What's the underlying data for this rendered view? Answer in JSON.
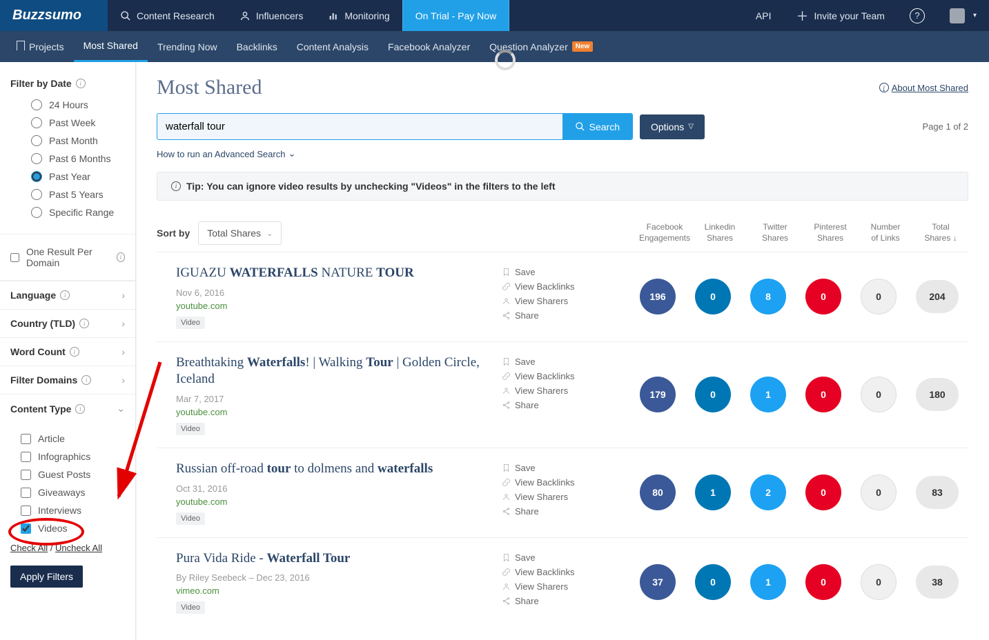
{
  "logo": "Buzzsumo",
  "topnav": {
    "content_research": "Content Research",
    "influencers": "Influencers",
    "monitoring": "Monitoring",
    "trial": "On Trial - Pay Now",
    "api": "API",
    "invite": "Invite your Team"
  },
  "subnav": {
    "projects": "Projects",
    "most_shared": "Most Shared",
    "trending": "Trending Now",
    "backlinks": "Backlinks",
    "content_analysis": "Content Analysis",
    "fb_analyzer": "Facebook Analyzer",
    "q_analyzer": "Question Analyzer",
    "new_badge": "New"
  },
  "sidebar": {
    "filter_date": "Filter by Date",
    "dates": [
      "24 Hours",
      "Past Week",
      "Past Month",
      "Past 6 Months",
      "Past Year",
      "Past 5 Years",
      "Specific Range"
    ],
    "date_selected": 4,
    "one_result": "One Result Per Domain",
    "language": "Language",
    "country": "Country (TLD)",
    "word_count": "Word Count",
    "filter_domains": "Filter Domains",
    "content_type": "Content Type",
    "types": [
      "Article",
      "Infographics",
      "Guest Posts",
      "Giveaways",
      "Interviews",
      "Videos"
    ],
    "type_checked": 5,
    "check_all": "Check All",
    "uncheck_all": "Uncheck All",
    "apply": "Apply Filters"
  },
  "main": {
    "title": "Most Shared",
    "about": "About Most Shared",
    "search_value": "waterfall tour",
    "search_btn": "Search",
    "options_btn": "Options",
    "page_info": "Page 1 of 2",
    "adv_search": "How to run an Advanced Search",
    "tip_label": "Tip:",
    "tip_text": "You can ignore video results by unchecking \"Videos\" in the filters to the left",
    "sort_label": "Sort by",
    "sort_value": "Total Shares",
    "columns": [
      "Facebook Engagements",
      "Linkedin Shares",
      "Twitter Shares",
      "Pinterest Shares",
      "Number of Links",
      "Total Shares"
    ],
    "actions": {
      "save": "Save",
      "backlinks": "View Backlinks",
      "sharers": "View Sharers",
      "share": "Share"
    },
    "video_tag": "Video"
  },
  "results": [
    {
      "title_html": "IGUAZU <b>WATERFALLS</b> NATURE <b>TOUR</b>",
      "date": "Nov 6, 2016",
      "byline": "",
      "domain": "youtube.com",
      "stats": {
        "fb": "196",
        "li": "0",
        "tw": "8",
        "pi": "0",
        "links": "0",
        "total": "204"
      }
    },
    {
      "title_html": "Breathtaking <b>Waterfalls</b>! | Walking <b>Tour</b> | Golden Circle, Iceland",
      "date": "Mar 7, 2017",
      "byline": "",
      "domain": "youtube.com",
      "stats": {
        "fb": "179",
        "li": "0",
        "tw": "1",
        "pi": "0",
        "links": "0",
        "total": "180"
      }
    },
    {
      "title_html": "Russian off-road <b>tour</b> to dolmens and <b>waterfalls</b>",
      "date": "Oct 31, 2016",
      "byline": "",
      "domain": "youtube.com",
      "stats": {
        "fb": "80",
        "li": "1",
        "tw": "2",
        "pi": "0",
        "links": "0",
        "total": "83"
      }
    },
    {
      "title_html": "Pura Vida Ride - <b>Waterfall Tour</b>",
      "date": "Dec 23, 2016",
      "byline": "By Riley Seebeck – ",
      "domain": "vimeo.com",
      "stats": {
        "fb": "37",
        "li": "0",
        "tw": "1",
        "pi": "0",
        "links": "0",
        "total": "38"
      }
    }
  ]
}
